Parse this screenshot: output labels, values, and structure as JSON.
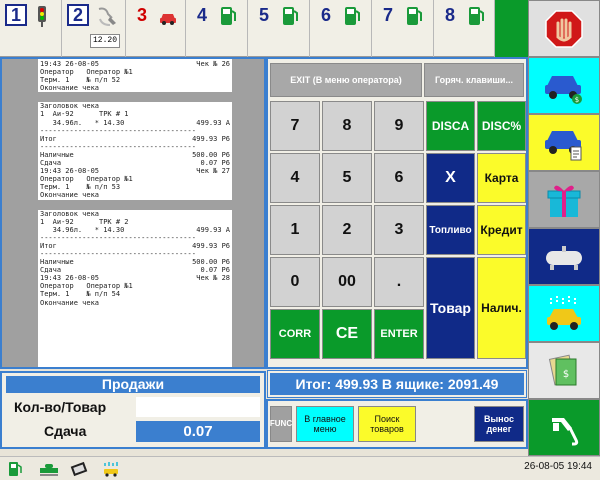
{
  "pumps": [
    {
      "number": "1",
      "style": "boxed",
      "icon": "traffic-light-icon"
    },
    {
      "number": "2",
      "style": "boxed",
      "icon": "nozzle-hose-icon",
      "amount": "12.20"
    },
    {
      "number": "3",
      "style": "red",
      "icon": "car-icon"
    },
    {
      "number": "4",
      "style": "normal",
      "icon": "fuel-pump-icon"
    },
    {
      "number": "5",
      "style": "normal",
      "icon": "fuel-pump-icon"
    },
    {
      "number": "6",
      "style": "normal",
      "icon": "fuel-pump-icon"
    },
    {
      "number": "7",
      "style": "normal",
      "icon": "fuel-pump-icon"
    },
    {
      "number": "8",
      "style": "normal",
      "icon": "fuel-pump-icon"
    }
  ],
  "receipt": {
    "block1": [
      {
        "l": "19:43 26-08-05",
        "r": "Чек № 26"
      },
      {
        "l": "Оператор   Оператор №1",
        "r": ""
      },
      {
        "l": "Терм. 1    № п/п 52",
        "r": ""
      },
      {
        "l": "Окончание чека",
        "r": ""
      }
    ],
    "block2": [
      {
        "l": "Заголовок чека",
        "r": ""
      },
      {
        "l": "1  Аи-92      ТРК # 1",
        "r": ""
      },
      {
        "l": "   34.96л.   * 14.30",
        "r": "499.93 А"
      },
      {
        "l": "-------------------------------------",
        "r": ""
      },
      {
        "l": "Итог",
        "r": "499.93 Р6"
      },
      {
        "l": "-------------------------------------",
        "r": ""
      },
      {
        "l": "Наличные",
        "r": "500.00 Р6"
      },
      {
        "l": "Сдача",
        "r": "0.07 Р6"
      },
      {
        "l": "19:43 26-08-05",
        "r": "Чек № 27"
      },
      {
        "l": "Оператор   Оператор №1",
        "r": ""
      },
      {
        "l": "Терм. 1    № п/п 53",
        "r": ""
      },
      {
        "l": "Окончание чека",
        "r": ""
      }
    ],
    "block3": [
      {
        "l": "Заголовок чека",
        "r": ""
      },
      {
        "l": "1  Аи-92      ТРК # 2",
        "r": ""
      },
      {
        "l": "   34.96л.   * 14.30",
        "r": "499.93 А"
      },
      {
        "l": "-------------------------------------",
        "r": ""
      },
      {
        "l": "Итог",
        "r": "499.93 Р6"
      },
      {
        "l": "-------------------------------------",
        "r": ""
      },
      {
        "l": "Наличные",
        "r": "500.00 Р6"
      },
      {
        "l": "Сдача",
        "r": "0.07 Р6"
      },
      {
        "l": "19:43 26-08-05",
        "r": "Чек № 28"
      },
      {
        "l": "Оператор   Оператор №1",
        "r": ""
      },
      {
        "l": "Терм. 1    № п/п 54",
        "r": ""
      },
      {
        "l": "Окончание чека",
        "r": ""
      }
    ]
  },
  "keypad": {
    "exit": "EXIT (В меню оператора)",
    "hotkeys": "Горяч. клавиши...",
    "digits": [
      "7",
      "8",
      "9",
      "4",
      "5",
      "6",
      "1",
      "2",
      "3",
      "0",
      "00",
      "."
    ],
    "corr": "CORR",
    "ce": "CE",
    "enter": "ENTER",
    "disca": "DISCA",
    "disc_pct": "DISC%",
    "x": "X",
    "card": "Карта",
    "fuel": "Топливо",
    "credit": "Кредит",
    "goods": "Товар",
    "cash": "Налич."
  },
  "sales": {
    "title": "Продажи",
    "qty_label": "Кол-во/Товар",
    "qty_value": "",
    "change_label": "Сдача",
    "change_value": "0.07"
  },
  "total_line": "Итог: 499.93  В ящике: 2091.49",
  "functions": {
    "func": "FUNC",
    "main_menu": "В главное меню",
    "search_goods": "Поиск товаров",
    "cash_out": "Вынос денег"
  },
  "status": {
    "datetime": "26-08-05  19:44"
  },
  "colors": {
    "blue_accent": "#3b7fcf",
    "green": "#0a9a2a",
    "navy": "#102a88",
    "yellow": "#fbfb2a",
    "cyan": "#00ffff",
    "red": "#d00000"
  }
}
